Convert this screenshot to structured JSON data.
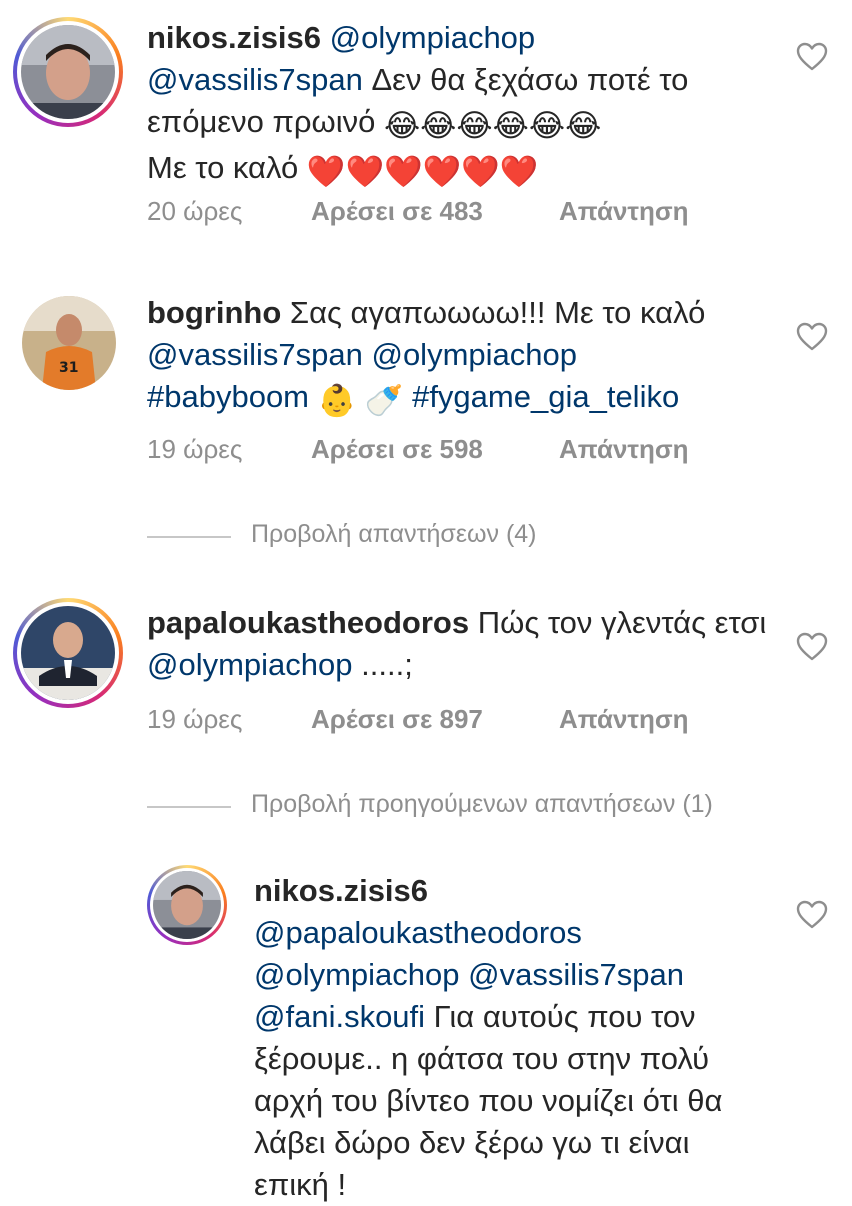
{
  "comments": [
    {
      "username": "nikos.zisis6",
      "parts": [
        {
          "t": "@olympiachop",
          "link": true
        },
        {
          "t": " ",
          "link": false
        },
        {
          "t": "@vassilis7span",
          "link": true
        },
        {
          "t": " Δεν θα ξεχάσω ποτέ το επόμενο πρωινό ",
          "link": false
        }
      ],
      "emoji_line1": "😂😂😂😂😂😂",
      "line_end_text": "Με το καλό ",
      "emoji_line2": "❤️❤️❤️❤️❤️❤️",
      "time": "20 ώρες",
      "likes": "Αρέσει σε 483",
      "reply": "Απάντηση"
    },
    {
      "username": "bogrinho",
      "text_a": " Σας αγαπωωωω!!! Με το καλό ",
      "mention1": "@vassilis7span",
      "mention2": "@olympiachop",
      "hashtag1": "#babyboom",
      "emoji": "👶 🍼",
      "hashtag2": "#fygame_gia_teliko",
      "time": "19 ώρες",
      "likes": "Αρέσει σε 598",
      "reply": "Απάντηση",
      "view_replies": "Προβολή απαντήσεων (4)"
    },
    {
      "username": "papaloukastheodoros",
      "text_a": " Πώς τον γλεντάς ετσι ",
      "mention1": "@olympiachop",
      "text_b": " .....;",
      "time": "19 ώρες",
      "likes": "Αρέσει σε 897",
      "reply": "Απάντηση",
      "view_previous": "Προβολή προηγούμενων απαντήσεων (1)"
    }
  ],
  "reply": {
    "username": "nikos.zisis6",
    "mention1": "@papaloukastheodoros",
    "mention2": "@olympiachop",
    "mention3": "@vassilis7span",
    "mention4": "@fani.skoufi",
    "text": " Για αυτούς που τον ξέρουμε.. η φάτσα του στην πολύ αρχή του βίντεο που νομίζει ότι θα λάβει δώρο δεν ξέρω γω τι είναι επική !"
  },
  "icons": {
    "like": "heart-outline-icon"
  },
  "colors": {
    "link": "#00376b",
    "meta": "#8e8e8e",
    "text": "#262626"
  }
}
